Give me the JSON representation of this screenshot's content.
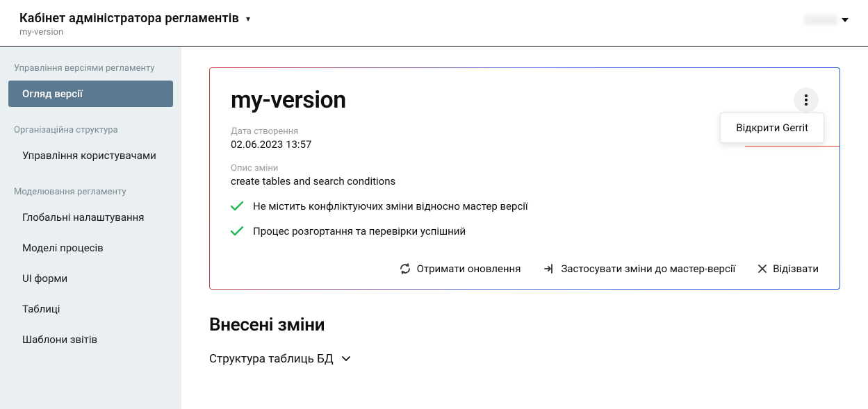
{
  "header": {
    "title": "Кабінет адміністратора регламентів",
    "subtitle": "my-version"
  },
  "sidebar": {
    "section1_label": "Управління версіями регламенту",
    "items1": [
      "Огляд версії"
    ],
    "section2_label": "Організаційна структура",
    "items2": [
      "Управління користувачами"
    ],
    "section3_label": "Моделювання регламенту",
    "items3": [
      "Глобальні налаштування",
      "Моделі процесів",
      "UI форми",
      "Таблиці",
      "Шаблони звітів"
    ]
  },
  "card": {
    "title": "my-version",
    "created_label": "Дата створення",
    "created_value": "02.06.2023 13:57",
    "change_label": "Опис зміни",
    "change_value": "create tables and search conditions",
    "status1": "Не містить конфліктуючих зміни відносно мастер версії",
    "status2": "Процес розгортання та перевірки успішний",
    "popover_item": "Відкрити Gerrit",
    "action_refresh": "Отримати оновлення",
    "action_apply": "Застосувати зміни до мастер-версії",
    "action_recall": "Відізвати"
  },
  "changes": {
    "title": "Внесені зміни",
    "collapser": "Структура таблиць БД"
  }
}
